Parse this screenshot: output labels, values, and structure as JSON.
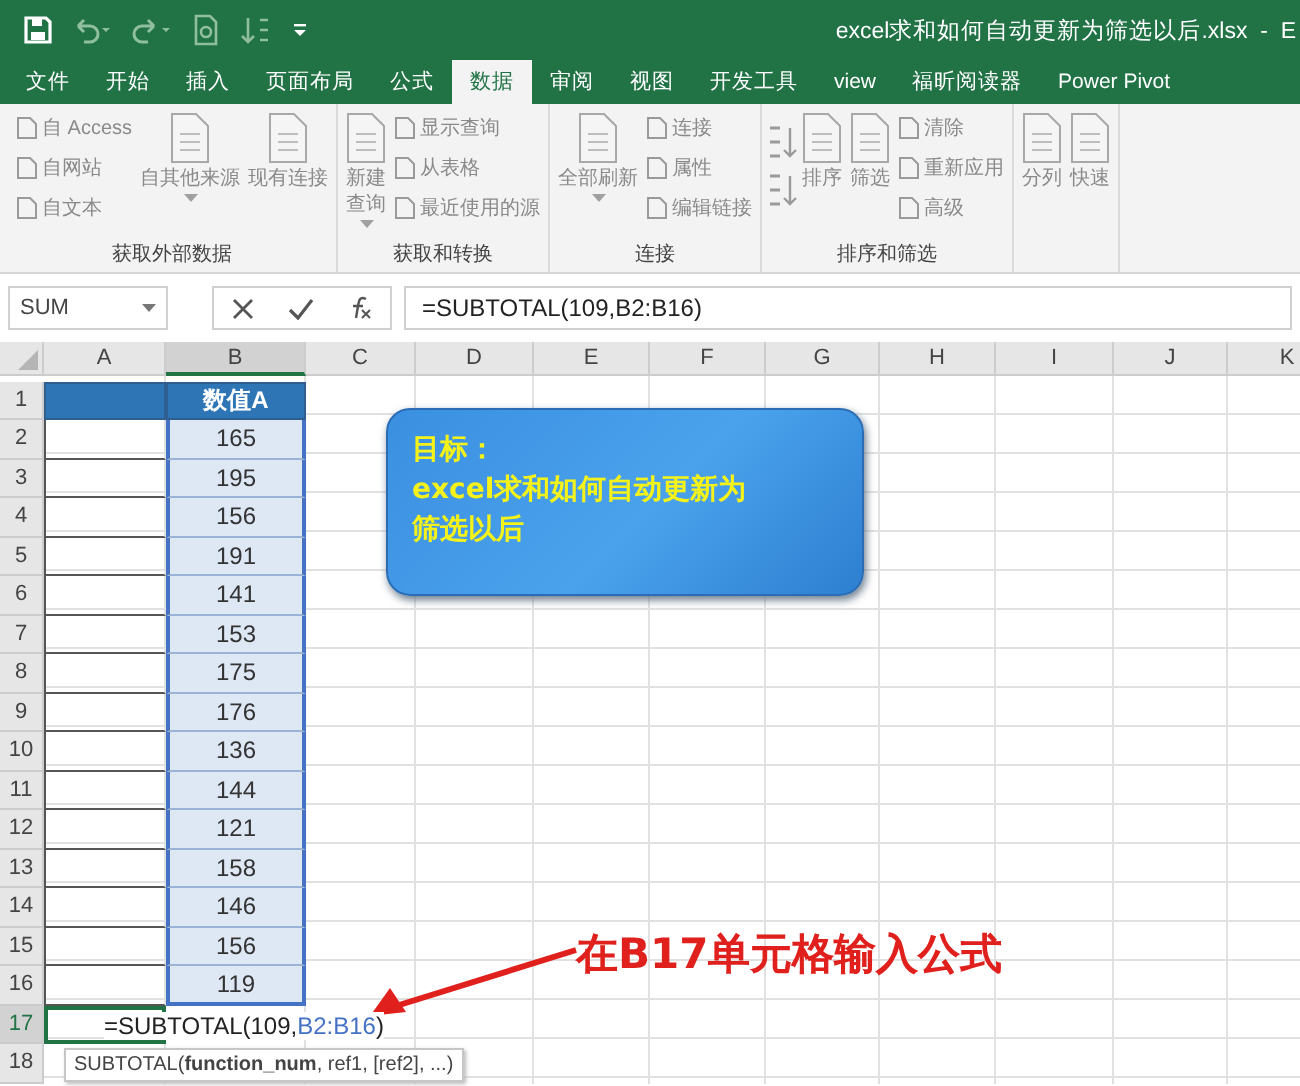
{
  "title_bar": {
    "title": "excel求和如何自动更新为筛选以后.xlsx  -  E"
  },
  "tabs": [
    {
      "label": "文件",
      "selected": false
    },
    {
      "label": "开始",
      "selected": false
    },
    {
      "label": "插入",
      "selected": false
    },
    {
      "label": "页面布局",
      "selected": false
    },
    {
      "label": "公式",
      "selected": false
    },
    {
      "label": "数据",
      "selected": true
    },
    {
      "label": "审阅",
      "selected": false
    },
    {
      "label": "视图",
      "selected": false
    },
    {
      "label": "开发工具",
      "selected": false
    },
    {
      "label": "view",
      "selected": false
    },
    {
      "label": "福昕阅读器",
      "selected": false
    },
    {
      "label": "Power Pivot",
      "selected": false
    }
  ],
  "ribbon_groups": [
    {
      "label": "获取外部数据",
      "items": [
        {
          "kind": "stack",
          "buttons": [
            "自 Access",
            "自网站",
            "自文本"
          ]
        },
        {
          "kind": "large",
          "label": "自其他来源",
          "dropdown": true
        },
        {
          "kind": "large",
          "label": "现有连接",
          "dropdown": false
        }
      ]
    },
    {
      "label": "获取和转换",
      "items": [
        {
          "kind": "large",
          "lines": [
            "新建",
            "查询"
          ],
          "dropdown": true
        },
        {
          "kind": "stack",
          "buttons": [
            "显示查询",
            "从表格",
            "最近使用的源"
          ]
        }
      ]
    },
    {
      "label": "连接",
      "items": [
        {
          "kind": "large",
          "label": "全部刷新",
          "dropdown": true
        },
        {
          "kind": "stack",
          "buttons": [
            "连接",
            "属性",
            "编辑链接"
          ]
        }
      ]
    },
    {
      "label": "排序和筛选",
      "items": [
        {
          "kind": "sortpair"
        },
        {
          "kind": "large",
          "label": "排序",
          "dropdown": false
        },
        {
          "kind": "large",
          "label": "筛选",
          "dropdown": false
        },
        {
          "kind": "stack",
          "buttons": [
            "清除",
            "重新应用",
            "高级"
          ]
        }
      ]
    },
    {
      "items": [
        {
          "kind": "large",
          "label": "分列",
          "dropdown": false
        },
        {
          "kind": "large",
          "label": "快速",
          "dropdown": false
        }
      ]
    }
  ],
  "formula_bar": {
    "name_box": "SUM",
    "formula": "=SUBTOTAL(109,B2:B16)"
  },
  "columns": [
    {
      "label": "A",
      "selected": false
    },
    {
      "label": "B",
      "selected": true
    },
    {
      "label": "C",
      "selected": false
    },
    {
      "label": "D",
      "selected": false
    },
    {
      "label": "E",
      "selected": false
    },
    {
      "label": "F",
      "selected": false
    },
    {
      "label": "G",
      "selected": false
    },
    {
      "label": "H",
      "selected": false
    },
    {
      "label": "I",
      "selected": false
    },
    {
      "label": "J",
      "selected": false
    },
    {
      "label": "K",
      "selected": false
    }
  ],
  "rows": [
    {
      "number": "1",
      "selected": false
    },
    {
      "number": "2",
      "selected": false
    },
    {
      "number": "3",
      "selected": false
    },
    {
      "number": "4",
      "selected": false
    },
    {
      "number": "5",
      "selected": false
    },
    {
      "number": "6",
      "selected": false
    },
    {
      "number": "7",
      "selected": false
    },
    {
      "number": "8",
      "selected": false
    },
    {
      "number": "9",
      "selected": false
    },
    {
      "number": "10",
      "selected": false
    },
    {
      "number": "11",
      "selected": false
    },
    {
      "number": "12",
      "selected": false
    },
    {
      "number": "13",
      "selected": false
    },
    {
      "number": "14",
      "selected": false
    },
    {
      "number": "15",
      "selected": false
    },
    {
      "number": "16",
      "selected": false
    },
    {
      "number": "17",
      "selected": true
    },
    {
      "number": "18",
      "selected": false
    }
  ],
  "table": {
    "header": "数值A",
    "values": [
      "165",
      "195",
      "156",
      "191",
      "141",
      "153",
      "175",
      "176",
      "136",
      "144",
      "121",
      "158",
      "146",
      "156",
      "119"
    ]
  },
  "editing_cell": {
    "before": "=SUBTOTAL(109,",
    "reference": "B2:B16",
    "after": ")"
  },
  "formula_tooltip": "SUBTOTAL(**function_num**, ref1, [ref2], ...)",
  "callout": {
    "lines": [
      "目标：",
      "excel求和如何自动更新为",
      "筛选以后"
    ]
  },
  "annotation": "在B17单元格输入公式"
}
